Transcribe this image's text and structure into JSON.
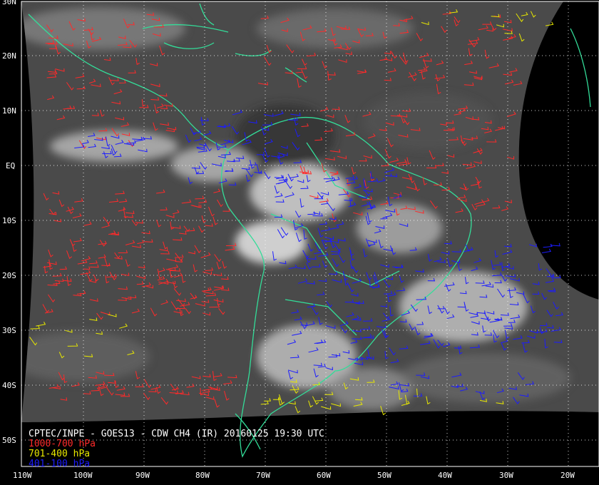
{
  "title": "CPTEC/INPE - GOES13 - CDW CH4 (IR) 20160125 19:30 UTC",
  "legend": [
    {
      "label": "1000-700 hPa",
      "color": "#ff2a2a"
    },
    {
      "label": "701-400 hPa",
      "color": "#e8e800"
    },
    {
      "label": "401-100 hPa",
      "color": "#1c1cff"
    }
  ],
  "colors": {
    "coastline": "#33dd99",
    "grid": "#ffffff",
    "background": "#000000",
    "satellite_disk": "#3c3c3c"
  },
  "latitude_labels": [
    "30N",
    "20N",
    "10N",
    "EQ",
    "10S",
    "20S",
    "30S",
    "40S",
    "50S"
  ],
  "longitude_labels": [
    "110W",
    "100W",
    "90W",
    "80W",
    "70W",
    "60W",
    "50W",
    "40W",
    "30W",
    "20W"
  ]
}
